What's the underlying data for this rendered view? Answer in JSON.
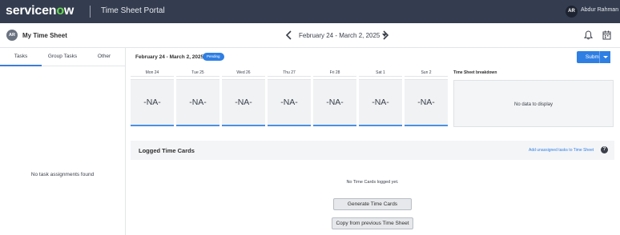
{
  "topbar": {
    "logo_text_before": "servicen",
    "logo_o": "o",
    "logo_text_after": "w",
    "portal_title": "Time Sheet Portal",
    "user_initials": "AR",
    "user_name": "Abdur Rahman"
  },
  "header": {
    "avatar_initials": "AR",
    "title": "My Time Sheet",
    "date_range": "February 24 - March 2, 2025"
  },
  "left_panel": {
    "tabs": [
      {
        "label": "Tasks",
        "active": true
      },
      {
        "label": "Group Tasks",
        "active": false
      },
      {
        "label": "Other",
        "active": false
      }
    ],
    "empty_message": "No task assignments found"
  },
  "main": {
    "period": "February 24 - March 2, 2025",
    "status_badge": "Pending",
    "submit_label": "Submit",
    "days": [
      {
        "label": "Mon 24",
        "value": "-NA-"
      },
      {
        "label": "Tue 25",
        "value": "-NA-"
      },
      {
        "label": "Wed 26",
        "value": "-NA-"
      },
      {
        "label": "Thu 27",
        "value": "-NA-"
      },
      {
        "label": "Fri 28",
        "value": "-NA-"
      },
      {
        "label": "Sat 1",
        "value": "-NA-"
      },
      {
        "label": "Sun 2",
        "value": "-NA-"
      }
    ],
    "breakdown_title": "Time Sheet breakdown",
    "breakdown_empty": "No data to display",
    "logged_title": "Logged Time Cards",
    "add_link": "Add unassigned tasks to Time Sheet",
    "help_glyph": "?",
    "no_cards": "No Time Cards logged yet.",
    "generate_button": "Generate Time Cards",
    "copy_button": "Copy from previous Time Sheet"
  },
  "colors": {
    "topbar_bg": "#343d4f",
    "accent_blue": "#2f7fe3",
    "logo_green": "#62d84e"
  }
}
